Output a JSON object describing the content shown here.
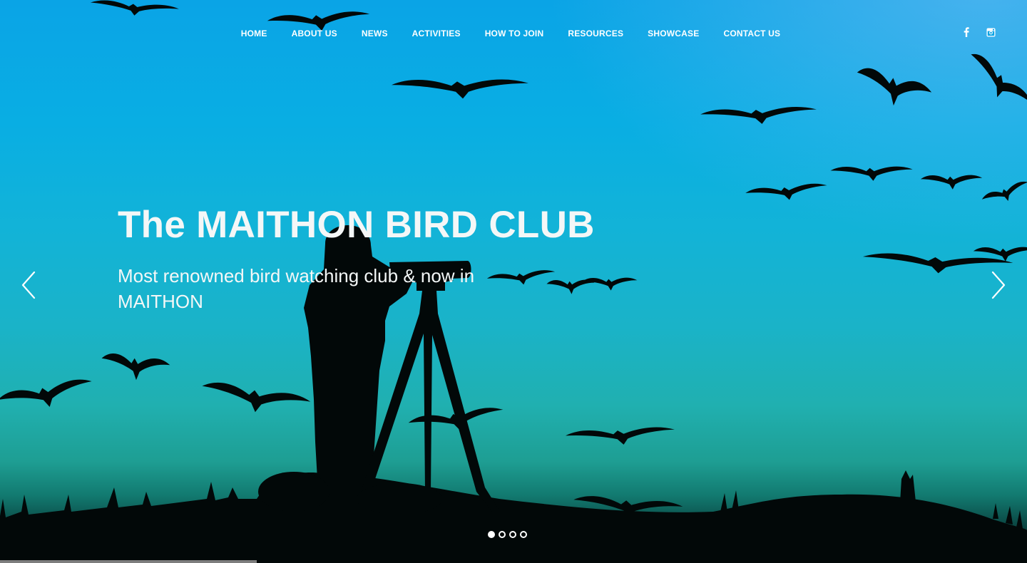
{
  "nav": {
    "items": [
      {
        "label": "HOME"
      },
      {
        "label": "ABOUT US"
      },
      {
        "label": "NEWS"
      },
      {
        "label": "ACTIVITIES"
      },
      {
        "label": "HOW TO JOIN"
      },
      {
        "label": "RESOURCES"
      },
      {
        "label": "SHOWCASE"
      },
      {
        "label": "CONTACT US"
      }
    ]
  },
  "social": {
    "icons": [
      "facebook-icon",
      "instagram-icon"
    ]
  },
  "hero": {
    "title": "The MAITHON BIRD CLUB",
    "subtitle": "Most renowned bird watching club & now in MAITHON",
    "prev_icon": "chevron-left-icon",
    "next_icon": "chevron-right-icon"
  },
  "slider": {
    "slide_count": 4,
    "active_slide": 1,
    "progress": 0.25
  },
  "colors": {
    "sky_top": "#0aa4e6",
    "sky_mid": "#1ab3c8",
    "horizon": "#127a70",
    "silhouette": "#020808",
    "text": "#f4f7f7"
  }
}
